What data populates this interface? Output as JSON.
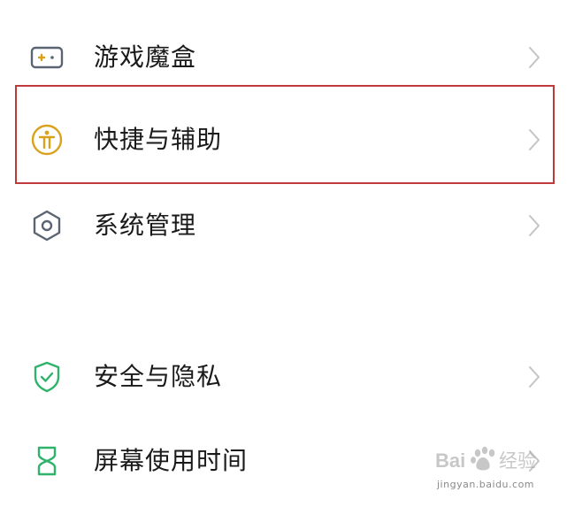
{
  "settings_list": {
    "items": [
      {
        "label": "游戏魔盒",
        "icon": "game-box-icon"
      },
      {
        "label": "快捷与辅助",
        "icon": "accessibility-icon",
        "highlighted": true
      },
      {
        "label": "系统管理",
        "icon": "system-hexagon-icon"
      },
      {
        "label": "安全与隐私",
        "icon": "shield-check-icon"
      },
      {
        "label": "屏幕使用时间",
        "icon": "hourglass-icon"
      }
    ]
  },
  "colors": {
    "game_icon": "#5a6472",
    "accessibility_icon": "#d9a21b",
    "system_icon": "#5a6472",
    "security_icon": "#2fb36a",
    "screentime_icon": "#2fb36a",
    "highlight_border": "#c0393b",
    "chevron": "#c4c4c4"
  },
  "watermark": {
    "brand": "Bai 经验",
    "url": "jingyan.baidu.com"
  }
}
